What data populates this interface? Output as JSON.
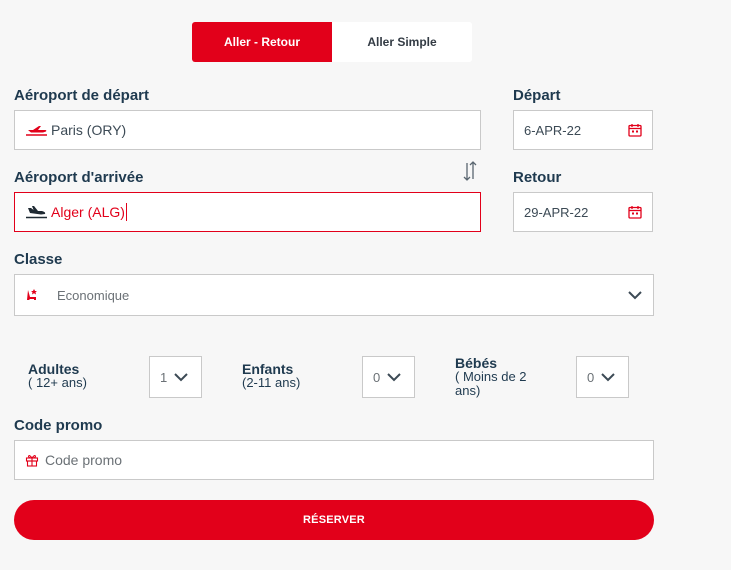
{
  "trip_type": {
    "round_trip_label": "Aller - Retour",
    "one_way_label": "Aller Simple",
    "selected": "round_trip"
  },
  "departure_airport": {
    "label": "Aéroport de départ",
    "value": "Paris (ORY)"
  },
  "arrival_airport": {
    "label": "Aéroport d'arrivée",
    "value": "Alger (ALG)",
    "state": "error"
  },
  "departure_date": {
    "label": "Départ",
    "value": "6-APR-22"
  },
  "return_date": {
    "label": "Retour",
    "value": "29-APR-22"
  },
  "cabin_class": {
    "label": "Classe",
    "value": "Economique"
  },
  "passengers": {
    "adults": {
      "label": "Adultes",
      "sub": "( 12+ ans)",
      "value": "1"
    },
    "children": {
      "label": "Enfants",
      "sub": "(2-11 ans)",
      "value": "0"
    },
    "infants": {
      "label": "Bébés",
      "sub": "( Moins de 2 ans)",
      "value": "0"
    }
  },
  "promo": {
    "label": "Code promo",
    "placeholder": "Code promo"
  },
  "reserve_button_label": "RÉSERVER",
  "colors": {
    "accent": "#e2001a",
    "label_text": "#1f3a4f",
    "border": "#c9c9c9",
    "background": "#f7f7f7"
  },
  "icons": {
    "takeoff": "plane-takeoff-icon",
    "landing": "plane-landing-icon",
    "swap": "swap-arrows-icon",
    "calendar": "calendar-icon",
    "seat": "seat-icon",
    "chevron": "chevron-down-icon",
    "gift": "gift-icon"
  }
}
